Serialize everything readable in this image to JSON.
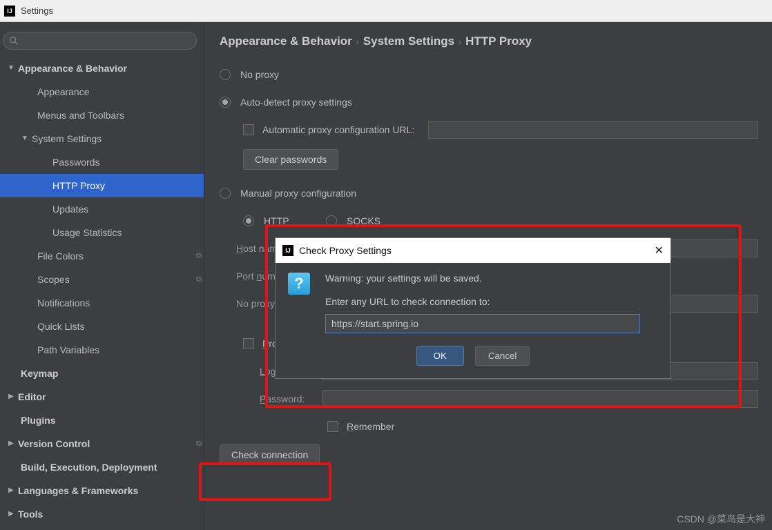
{
  "window": {
    "title": "Settings",
    "ij": "IJ"
  },
  "search": {
    "placeholder": ""
  },
  "tree": {
    "appearance_behavior": "Appearance & Behavior",
    "appearance": "Appearance",
    "menus_toolbars": "Menus and Toolbars",
    "system_settings": "System Settings",
    "passwords": "Passwords",
    "http_proxy": "HTTP Proxy",
    "updates": "Updates",
    "usage_statistics": "Usage Statistics",
    "file_colors": "File Colors",
    "scopes": "Scopes",
    "notifications": "Notifications",
    "quick_lists": "Quick Lists",
    "path_variables": "Path Variables",
    "keymap": "Keymap",
    "editor": "Editor",
    "plugins": "Plugins",
    "version_control": "Version Control",
    "build": "Build, Execution, Deployment",
    "langs": "Languages & Frameworks",
    "tools": "Tools"
  },
  "crumbs": {
    "a": "Appearance & Behavior",
    "b": "System Settings",
    "c": "HTTP Proxy"
  },
  "form": {
    "no_proxy": "No proxy",
    "auto_detect": "Auto-detect proxy settings",
    "auto_url": "Automatic proxy configuration URL:",
    "clear_passwords": "Clear passwords",
    "manual": "Manual proxy configuration",
    "http": "HTTP",
    "socks": "SOCKS",
    "host_u": "H",
    "host_rest": "ost name:",
    "port_u": "n",
    "port_pre": "Port ",
    "port_rest": "umber:",
    "no_proxy_for": "No proxy for:",
    "proxy_auth_u": "P",
    "proxy_auth_rest": "roxy authentication",
    "login_u": "L",
    "login_rest": "ogin:",
    "password_u": "P",
    "password_rest": "assword:",
    "remember_u": "R",
    "remember_rest": "emember",
    "check_connection": "Check connection"
  },
  "dialog": {
    "title": "Check Proxy Settings",
    "warning": "Warning: your settings will be saved.",
    "prompt": "Enter any URL to check connection to:",
    "url": "https://start.spring.io",
    "ok": "OK",
    "cancel": "Cancel"
  },
  "watermark": "CSDN @菜鸟是大神"
}
